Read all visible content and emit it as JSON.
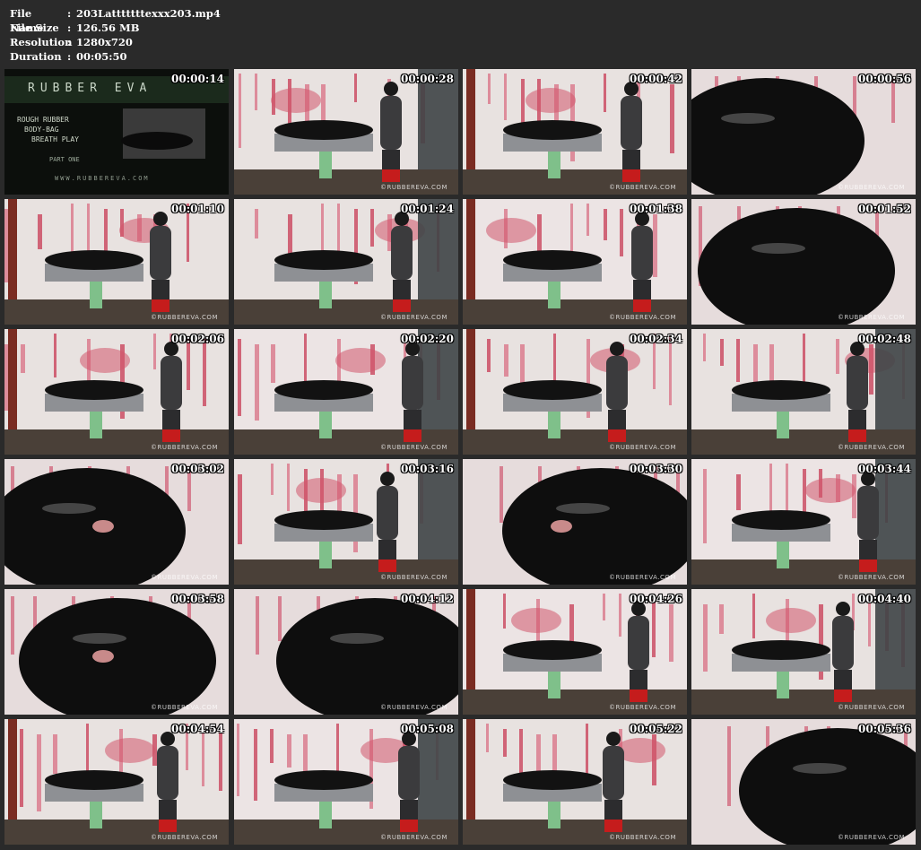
{
  "info": {
    "rows": [
      {
        "key": "File Name",
        "sep": ":",
        "value": "203Latttttttexxx203.mp4"
      },
      {
        "key": "File Size",
        "sep": ":",
        "value": "126.56 MB"
      },
      {
        "key": "Resolution",
        "sep": ":",
        "value": "1280x720"
      },
      {
        "key": "Duration",
        "sep": ":",
        "value": "00:05:50"
      }
    ]
  },
  "title_card": {
    "brand": "RUBBER EVA",
    "lines": [
      "ROUGH RUBBER",
      "BODY-BAG",
      "BREATH PLAY"
    ],
    "part": "PART ONE",
    "site": "WWW.RUBBEREVA.COM"
  },
  "watermark": "©RUBBEREVA.COM",
  "thumbnails": [
    {
      "time": "00:00:14"
    },
    {
      "time": "00:00:28"
    },
    {
      "time": "00:00:42"
    },
    {
      "time": "00:00:56"
    },
    {
      "time": "00:01:10"
    },
    {
      "time": "00:01:24"
    },
    {
      "time": "00:01:38"
    },
    {
      "time": "00:01:52"
    },
    {
      "time": "00:02:06"
    },
    {
      "time": "00:02:20"
    },
    {
      "time": "00:02:34"
    },
    {
      "time": "00:02:48"
    },
    {
      "time": "00:03:02"
    },
    {
      "time": "00:03:16"
    },
    {
      "time": "00:03:30"
    },
    {
      "time": "00:03:44"
    },
    {
      "time": "00:03:58"
    },
    {
      "time": "00:04:12"
    },
    {
      "time": "00:04:26"
    },
    {
      "time": "00:04:40"
    },
    {
      "time": "00:04:54"
    },
    {
      "time": "00:05:08"
    },
    {
      "time": "00:05:22"
    },
    {
      "time": "00:05:36"
    }
  ]
}
